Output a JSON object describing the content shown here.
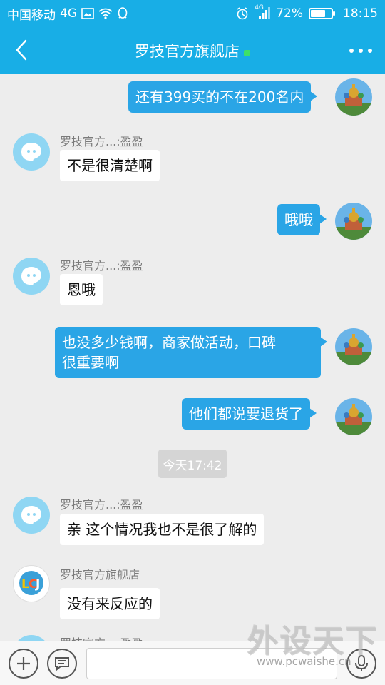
{
  "status_bar": {
    "carrier": "中国移动",
    "network": "4G",
    "signal_type": "4G",
    "battery": "72%",
    "battery_level": 0.72,
    "time": "18:15"
  },
  "header": {
    "title": "罗技官方旗舰店"
  },
  "messages": [
    {
      "side": "out",
      "text": "还有399买的不在200名内"
    },
    {
      "side": "in",
      "sender": "罗技官方...:盈盈",
      "text": "不是很清楚啊"
    },
    {
      "side": "out",
      "text": "哦哦"
    },
    {
      "side": "in",
      "sender": "罗技官方...:盈盈",
      "text": "恩哦"
    },
    {
      "side": "out",
      "text_line1": "也没多少钱啊，商家做活动，口碑",
      "text_line2": "很重要啊"
    },
    {
      "side": "out",
      "text": "他们都说要退货了"
    },
    {
      "side": "time",
      "text": "今天17:42"
    },
    {
      "side": "in",
      "sender": "罗技官方...:盈盈",
      "text": "亲 这个情况我也不是很了解的"
    },
    {
      "side": "in",
      "sender": "罗技官方旗舰店",
      "text": "没有来反应的"
    },
    {
      "side": "in",
      "sender": "罗技官方...:盈盈",
      "text": ""
    }
  ],
  "input_bar": {
    "placeholder": ""
  },
  "watermark": {
    "main": "外设天下",
    "sub": "www.pcwaishe.cn"
  },
  "colors": {
    "brand": "#18aee6",
    "bubble_out": "#2aa5e6",
    "background": "#ededed"
  },
  "icons": [
    "back-arrow-icon",
    "more-dots-icon",
    "add-icon",
    "emoji-list-icon",
    "microphone-icon",
    "wifi-icon",
    "alarm-icon",
    "signal-icon",
    "qq-icon",
    "gallery-icon"
  ]
}
